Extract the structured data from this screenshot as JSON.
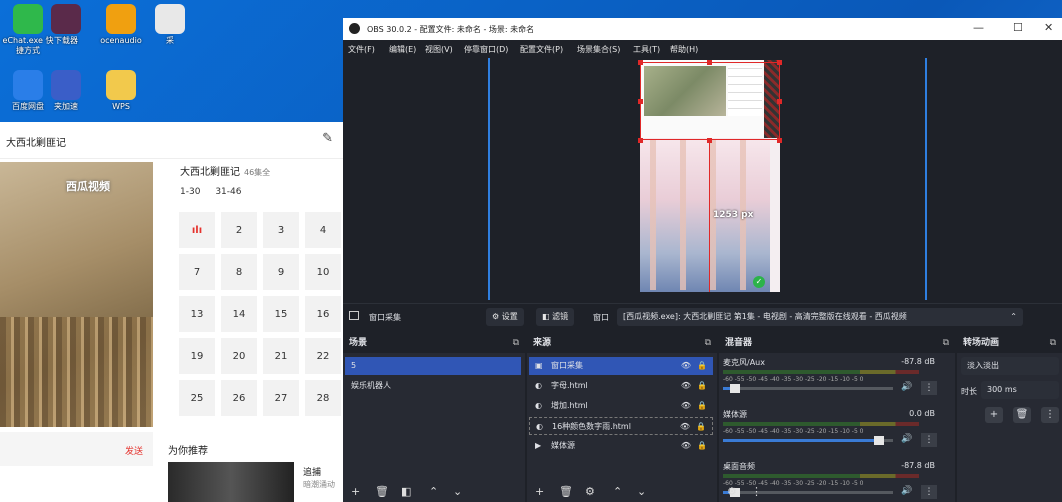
{
  "desktop": {
    "icons": [
      {
        "label": "eChat.exe 快捷方式",
        "color": "#2fb84b"
      },
      {
        "label": "下载器",
        "color": "#5a2a4a"
      },
      {
        "label": "ocenaudio",
        "color": "#f0a010"
      },
      {
        "label": "采",
        "color": "#e8e8e8"
      },
      {
        "label": "百度网盘",
        "color": "#2a7ee8"
      },
      {
        "label": "夹加速",
        "color": "#3a5ec8"
      },
      {
        "label": "WPS",
        "color": "#f2c94c"
      }
    ]
  },
  "browser": {
    "title": "大西北剿匪记",
    "video_logo": "西瓜视频",
    "series_title": "大西北剿匪记",
    "episode_count": "46集全",
    "ranges": [
      "1-30",
      "31-46"
    ],
    "playing_glyph": "ılı",
    "episodes": [
      "2",
      "3",
      "4",
      "7",
      "8",
      "9",
      "10",
      "13",
      "14",
      "15",
      "16",
      "19",
      "20",
      "21",
      "22",
      "25",
      "26",
      "27",
      "28"
    ],
    "send_label": "发送",
    "recommend_label": "为你推荐",
    "rec_title": "追捕",
    "rec_sub": "暗潮涌动"
  },
  "obs": {
    "title": "OBS 30.0.2 - 配置文件: 未命名 - 场景: 未命名",
    "menu": [
      "文件(F)",
      "编辑(E)",
      "视图(V)",
      "停靠窗口(D)",
      "配置文件(P)",
      "场景集合(S)",
      "工具(T)",
      "帮助(H)"
    ],
    "measure_label": "1253 px",
    "source_name": "窗口采集",
    "settings_label": "设置",
    "filters_label": "滤镜",
    "window_label": "窗口",
    "window_value": "[西瓜视频.exe]: 大西北剿匪记 第1集 - 电视剧 - 高清完整版在线观看 - 西瓜视频",
    "scenes": {
      "header": "场景",
      "items": [
        "5",
        "娱乐机器人"
      ]
    },
    "sources": {
      "header": "来源",
      "items": [
        {
          "name": "窗口采集",
          "icon": "window-capture-icon"
        },
        {
          "name": "字母.html",
          "icon": "browser-source-icon"
        },
        {
          "name": "增加.html",
          "icon": "browser-source-icon"
        },
        {
          "name": "16种颜色数字雨.html",
          "icon": "browser-source-icon"
        },
        {
          "name": "媒体源",
          "icon": "media-source-icon"
        }
      ]
    },
    "mixer": {
      "header": "混音器",
      "scale": [
        "-60",
        "-55",
        "-50",
        "-45",
        "-40",
        "-35",
        "-30",
        "-25",
        "-20",
        "-15",
        "-10",
        "-5",
        "0"
      ],
      "channels": [
        {
          "name": "麦克风/Aux",
          "db": "-87.8 dB",
          "level": 0.07
        },
        {
          "name": "媒体源",
          "db": "0.0 dB",
          "level": 0.92
        },
        {
          "name": "桌面音频",
          "db": "-87.8 dB",
          "level": 0.07
        }
      ]
    },
    "transitions": {
      "header": "转场动画",
      "selected": "淡入淡出",
      "duration_label": "时长",
      "duration_value": "300 ms"
    }
  }
}
